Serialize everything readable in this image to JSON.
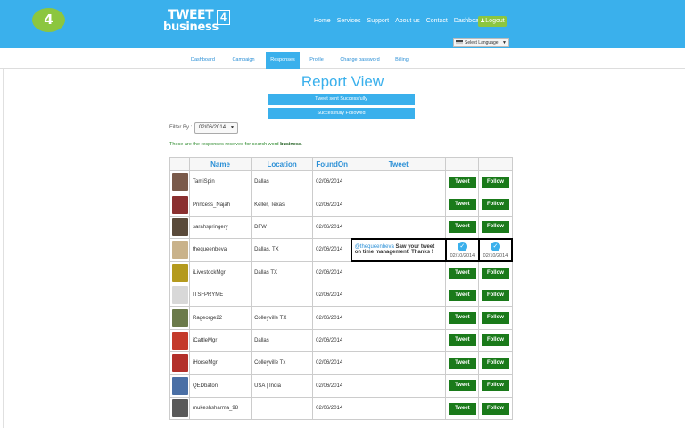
{
  "header": {
    "badge": "4",
    "logo_line1": "TWEET",
    "logo_line2": "business",
    "logo_box": "4",
    "nav": [
      "Home",
      "Services",
      "Support",
      "About us",
      "Contact",
      "Dashboard"
    ],
    "logout_label": "Logout",
    "language_label": "Select Language"
  },
  "subnav": [
    "Dashboard",
    "Campaign",
    "Responses",
    "Profile",
    "Change password",
    "Billing"
  ],
  "page": {
    "title": "Report View",
    "messages": [
      "Tweet sent Successfully",
      "Successfully Followed"
    ],
    "filter_label": "Filter By :",
    "filter_value": "02/06/2014",
    "note_prefix": "These are the responses received for search word",
    "note_keyword": "business",
    "note_suffix": "."
  },
  "table": {
    "headers": [
      "",
      "Name",
      "Location",
      "FoundOn",
      "Tweet",
      "",
      ""
    ],
    "tweet_button": "Tweet",
    "follow_button": "Follow",
    "rows": [
      {
        "name": "TamiSpin",
        "location": "Dallas",
        "found_on": "02/06/2014",
        "avatar_color": "#7a5a4a"
      },
      {
        "name": "Princess_Najah",
        "location": "Keller, Texas",
        "found_on": "02/06/2014",
        "avatar_color": "#8a2f2f"
      },
      {
        "name": "sarahspringery",
        "location": "DFW",
        "found_on": "02/06/2014",
        "avatar_color": "#5a4a3a"
      },
      {
        "name": "thequeenbeva",
        "location": "Dallas, TX",
        "found_on": "02/06/2014",
        "avatar_color": "#c9b28a",
        "tweet_handle": "@thequeenbeva",
        "tweet_text": "Saw your tweet on time management. Thanks !",
        "tweeted_date": "02/10/2014",
        "followed_date": "02/10/2014"
      },
      {
        "name": "iLivestockMgr",
        "location": "Dallas TX",
        "found_on": "02/06/2014",
        "avatar_color": "#b49a1e"
      },
      {
        "name": "ITSFPRYME",
        "location": "",
        "found_on": "02/06/2014",
        "avatar_color": "#d8d8d8"
      },
      {
        "name": "Rageorge22",
        "location": "Colleyville TX",
        "found_on": "02/06/2014",
        "avatar_color": "#6b7a4a"
      },
      {
        "name": "iCattleMgr",
        "location": "Dallas",
        "found_on": "02/06/2014",
        "avatar_color": "#c43a2a"
      },
      {
        "name": "iHorseMgr",
        "location": "Colleyville Tx",
        "found_on": "02/06/2014",
        "avatar_color": "#b3302a"
      },
      {
        "name": "QEDbaton",
        "location": "USA | India",
        "found_on": "02/06/2014",
        "avatar_color": "#4a6fa5"
      },
      {
        "name": "mukeshsharma_98",
        "location": "",
        "found_on": "02/06/2014",
        "avatar_color": "#5a5a5a"
      }
    ]
  },
  "colors": {
    "accent": "#3ab0ec",
    "green_button": "#1a7a1a",
    "logout_green": "#8cc63f"
  }
}
